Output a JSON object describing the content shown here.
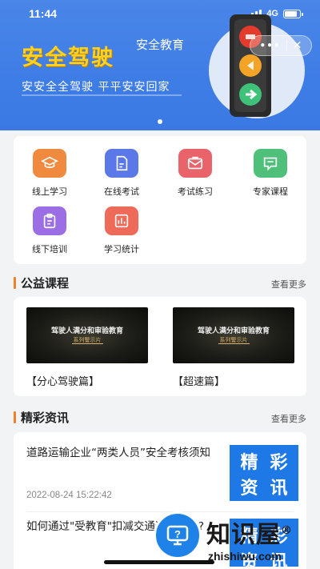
{
  "status_bar": {
    "time": "11:44",
    "network": "4G",
    "battery_level": 0.85
  },
  "banner": {
    "title": "安全驾驶",
    "tag": "安全教育",
    "subtitle": "安安全全驾驶  平平安安回家",
    "capsule_more": "•••",
    "capsule_close": "✕"
  },
  "grid": {
    "items": [
      {
        "label": "线上学习",
        "icon": "graduation-cap-icon",
        "color": "#f08a3e"
      },
      {
        "label": "在线考试",
        "icon": "document-edit-icon",
        "color": "#5a78e8"
      },
      {
        "label": "考试练习",
        "icon": "mail-icon",
        "color": "#e8646a"
      },
      {
        "label": "专家课程",
        "icon": "chat-bubble-icon",
        "color": "#4fc07a"
      },
      {
        "label": "线下培训",
        "icon": "clipboard-icon",
        "color": "#9b6ee6"
      },
      {
        "label": "学习统计",
        "icon": "stats-icon",
        "color": "#ee6b5a"
      }
    ]
  },
  "courses": {
    "title": "公益课程",
    "more": "查看更多",
    "items": [
      {
        "name": "【分心驾驶篇】",
        "thumb_title": "驾驶人满分和审验教育",
        "thumb_sub": "系列警示片"
      },
      {
        "name": "【超速篇】",
        "thumb_title": "驾驶人满分和审验教育",
        "thumb_sub": "系列警示片"
      }
    ]
  },
  "news": {
    "title": "精彩资讯",
    "more": "查看更多",
    "items": [
      {
        "title": "道路运输企业“两类人员”安全考核须知",
        "time": "2022-08-24 15:22:42",
        "thumb": [
          "精",
          "彩",
          "资",
          "讯"
        ]
      },
      {
        "title": "如何通过\"受教育\"扣减交通违法记分?",
        "time": "",
        "thumb": [
          "精",
          "彩",
          "资",
          "讯"
        ]
      }
    ]
  },
  "watermark": {
    "text": "知识屋",
    "mark": "®",
    "url": "zhishiwu.com"
  },
  "colors": {
    "banner": "#4a86e8",
    "accent": "#f0812a",
    "title_yellow": "#ffd21f"
  }
}
